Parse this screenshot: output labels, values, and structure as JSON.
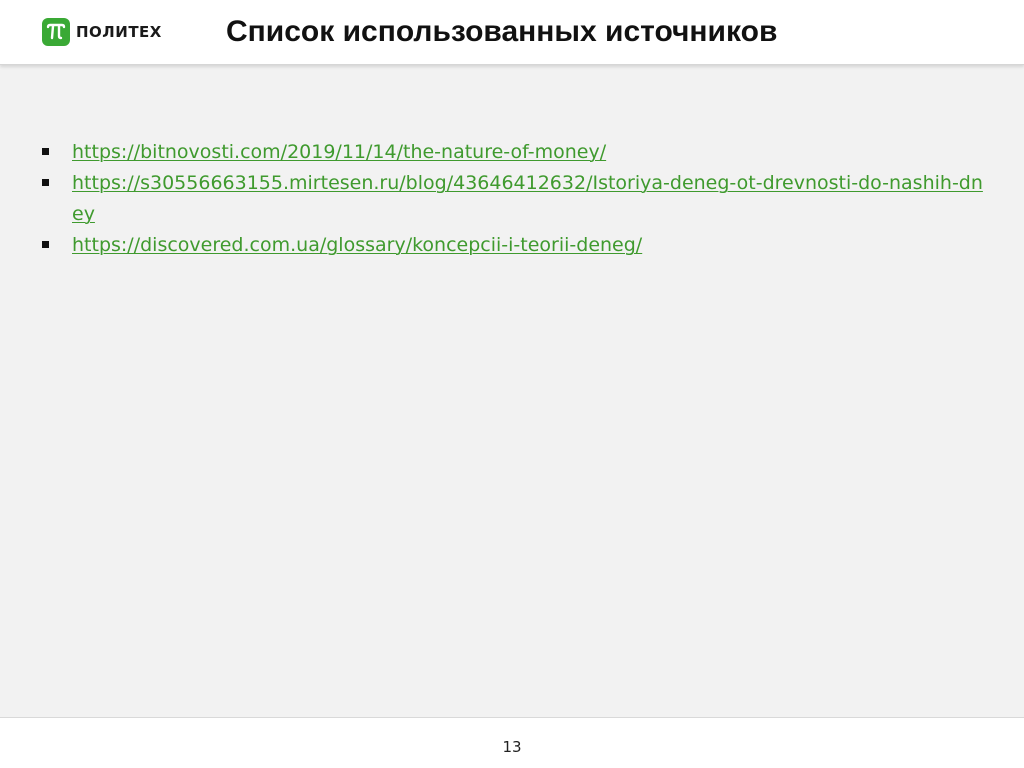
{
  "header": {
    "logo_text": "ПОЛИТЕХ",
    "title": "Список использованных источников",
    "brand_color": "#3aa935",
    "logo_icon": "pi-logo-icon"
  },
  "sources": [
    {
      "url": "https://bitnovosti.com/2019/11/14/the-nature-of-money/"
    },
    {
      "url": "https://s30556663155.mirtesen.ru/blog/43646412632/Istoriya-deneg-ot-drevnosti-do-nashih-dney"
    },
    {
      "url": "https://discovered.com.ua/glossary/koncepcii-i-teorii-deneg/"
    }
  ],
  "link_color": "#3f9a2e",
  "footer": {
    "page_number": "13"
  }
}
